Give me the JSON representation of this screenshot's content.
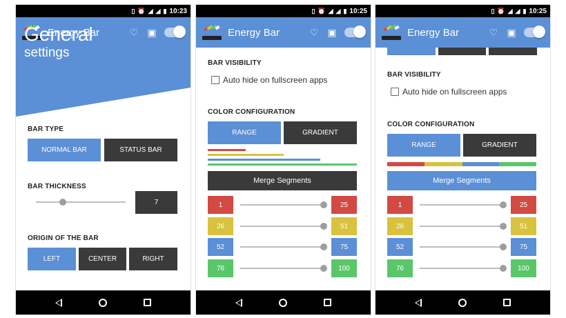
{
  "status_bar": {
    "time": "10:23",
    "time2": "10:25",
    "time3": "10:25"
  },
  "app": {
    "title": "Energy Bar"
  },
  "colors": {
    "blue": "#5b8fd6",
    "dark": "#3a3a3a",
    "red": "#d24a43",
    "yellow": "#d8c23e",
    "blue_seg": "#5b8fd6",
    "green": "#5ac66a"
  },
  "general": {
    "title": "General",
    "subtitle": "settings",
    "bar_type_label": "BAR TYPE",
    "bar_type_options": [
      "NORMAL BAR",
      "STATUS BAR"
    ],
    "bar_thickness_label": "BAR THICKNESS",
    "bar_thickness_value": "7",
    "origin_label": "ORIGIN OF THE BAR",
    "origin_options": [
      "LEFT",
      "CENTER",
      "RIGHT"
    ]
  },
  "visibility": {
    "label": "BAR VISIBILITY",
    "auto_hide_label": "Auto hide on fullscreen apps"
  },
  "color_config": {
    "label": "COLOR CONFIGURATION",
    "modes": [
      "RANGE",
      "GRADIENT"
    ],
    "merge_label": "Merge Segments",
    "segments": [
      {
        "from": "1",
        "to": "25"
      },
      {
        "from": "26",
        "to": "51"
      },
      {
        "from": "52",
        "to": "75"
      },
      {
        "from": "76",
        "to": "100"
      }
    ]
  }
}
